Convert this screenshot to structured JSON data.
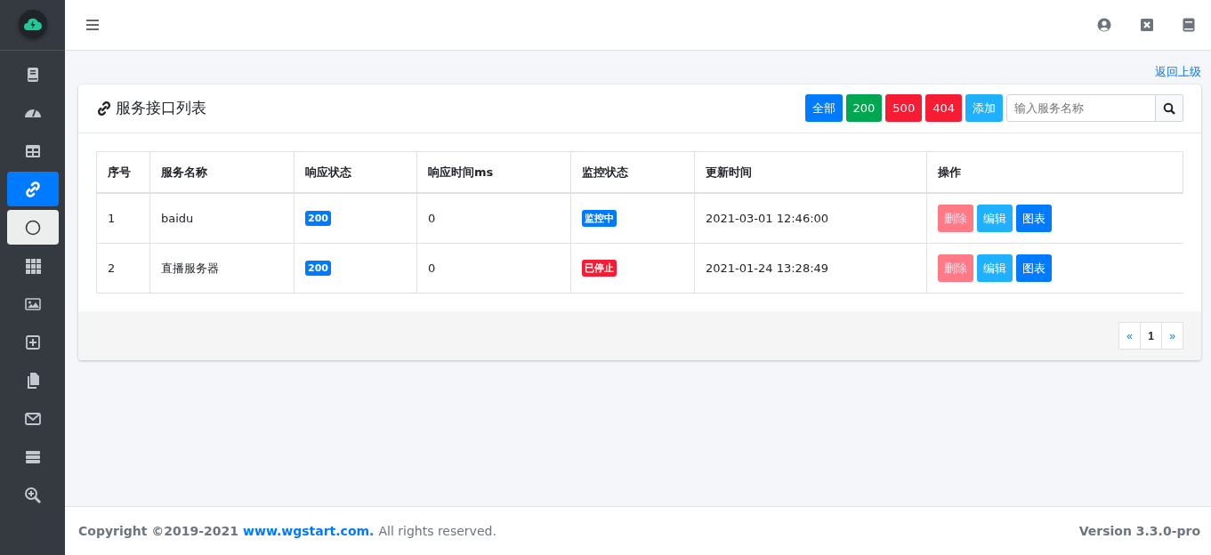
{
  "sidebar": {
    "items": [
      {
        "kind": "book",
        "selected": false,
        "focused": false
      },
      {
        "kind": "gauge",
        "selected": false,
        "focused": false
      },
      {
        "kind": "table",
        "selected": false,
        "focused": false
      },
      {
        "kind": "link",
        "selected": true,
        "focused": false
      },
      {
        "kind": "circle",
        "selected": false,
        "focused": true
      },
      {
        "kind": "grid",
        "selected": false,
        "focused": false
      },
      {
        "kind": "image",
        "selected": false,
        "focused": false
      },
      {
        "kind": "plus",
        "selected": false,
        "focused": false
      },
      {
        "kind": "copy",
        "selected": false,
        "focused": false
      },
      {
        "kind": "mail",
        "selected": false,
        "focused": false
      },
      {
        "kind": "server",
        "selected": false,
        "focused": false
      },
      {
        "kind": "zoom",
        "selected": false,
        "focused": false
      }
    ]
  },
  "back_link": "返回上级",
  "card": {
    "title": "服务接口列表",
    "filters": [
      {
        "label": "全部",
        "color": "#007bff"
      },
      {
        "label": "200",
        "color": "#00a650"
      },
      {
        "label": "500",
        "color": "#f51c33"
      },
      {
        "label": "404",
        "color": "#f51c33"
      },
      {
        "label": "添加",
        "color": "#1fb0ff"
      }
    ],
    "search": {
      "placeholder": "输入服务名称"
    },
    "table": {
      "columns": [
        "序号",
        "服务名称",
        "响应状态",
        "响应时间ms",
        "监控状态",
        "更新时间",
        "操作"
      ],
      "rows": [
        {
          "index": "1",
          "name": "baidu",
          "response_status": "200",
          "response_time": "0",
          "monitor": {
            "label": "监控中",
            "color": "#007bff"
          },
          "updated": "2021-03-01 12:46:00",
          "actions": [
            {
              "label": "删除",
              "kind": "delete",
              "disabled": true
            },
            {
              "label": "编辑",
              "kind": "edit",
              "disabled": false
            },
            {
              "label": "图表",
              "kind": "chart",
              "disabled": false
            }
          ]
        },
        {
          "index": "2",
          "name": "直播服务器",
          "response_status": "200",
          "response_time": "0",
          "monitor": {
            "label": "已停止",
            "color": "#f51c33"
          },
          "updated": "2021-01-24 13:28:49",
          "actions": [
            {
              "label": "删除",
              "kind": "delete",
              "disabled": true
            },
            {
              "label": "编辑",
              "kind": "edit",
              "disabled": false
            },
            {
              "label": "图表",
              "kind": "chart",
              "disabled": false
            }
          ]
        }
      ]
    },
    "pagination": [
      {
        "label": "«",
        "selected": false
      },
      {
        "label": "1",
        "selected": true
      },
      {
        "label": "»",
        "selected": false
      }
    ]
  },
  "footer": {
    "copyright": "Copyright ©2019-2021",
    "link": "www.wgstart.com.",
    "rights": "All rights reserved.",
    "version": "Version 3.3.0-pro"
  }
}
